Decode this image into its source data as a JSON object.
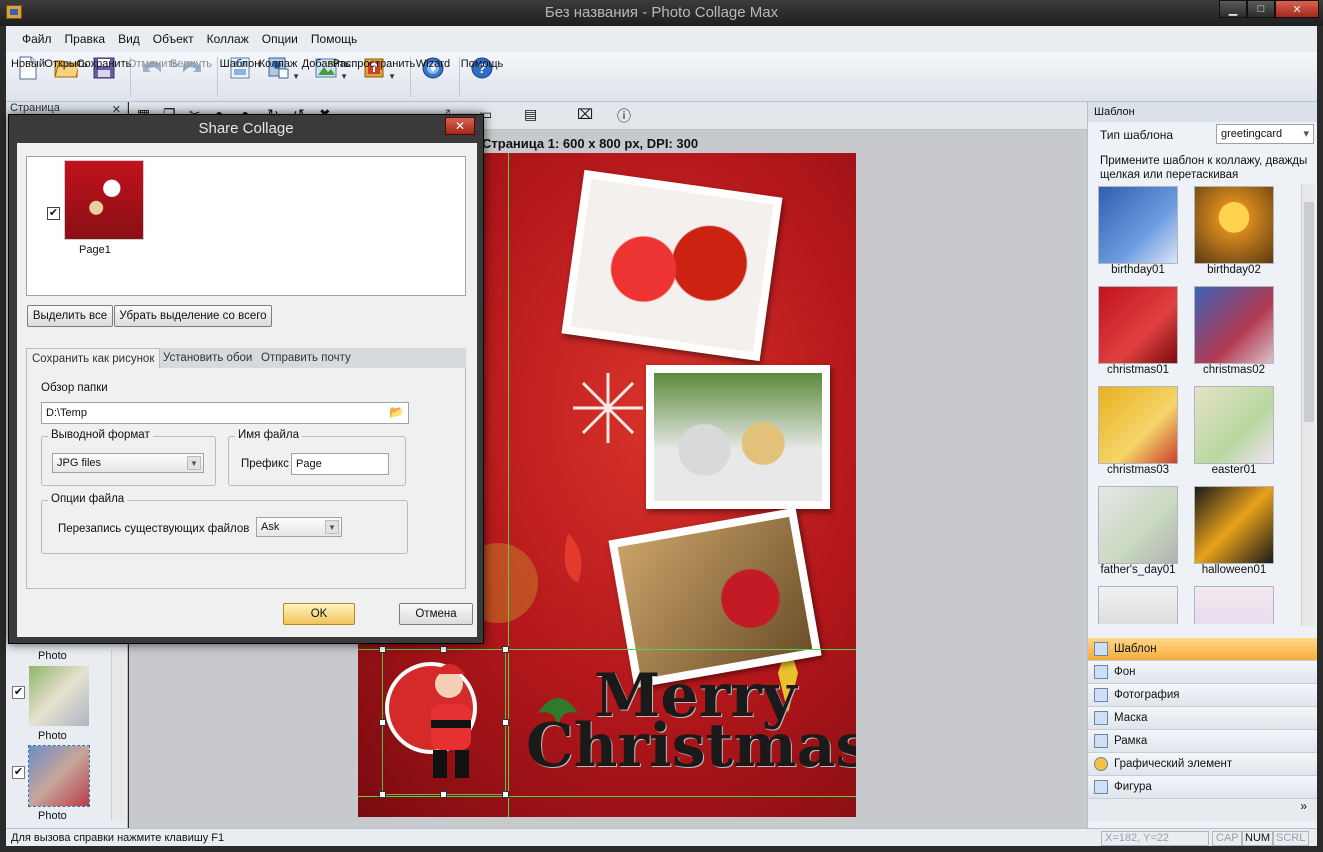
{
  "window": {
    "title": "Без названия - Photo Collage Max",
    "minimize": "▁",
    "maximize": "□",
    "close": "✕"
  },
  "menu": [
    "Файл",
    "Правка",
    "Вид",
    "Объект",
    "Коллаж",
    "Опции",
    "Помощь"
  ],
  "toolbar": {
    "buttons": [
      {
        "label": "Новый",
        "icon": "new-file-icon"
      },
      {
        "label": "Открыть",
        "icon": "open-folder-icon"
      },
      {
        "label": "Сохранить",
        "icon": "save-icon"
      },
      {
        "label": "Отменить",
        "icon": "undo-icon",
        "disabled": true
      },
      {
        "label": "Вернуть",
        "icon": "redo-icon",
        "disabled": true
      },
      {
        "label": "Шаблон",
        "icon": "template-icon"
      },
      {
        "label": "Коллаж",
        "icon": "collage-icon",
        "dropdown": true
      },
      {
        "label": "Добавить",
        "icon": "add-image-icon",
        "dropdown": true
      },
      {
        "label": "Распространить",
        "icon": "share-icon",
        "dropdown": true
      },
      {
        "label": "Wizard",
        "icon": "wizard-icon"
      },
      {
        "label": "Помощь",
        "icon": "help-icon"
      }
    ]
  },
  "left_panel": {
    "title": "Страница",
    "close": "✕",
    "photos": [
      {
        "caption": "Photo",
        "checked": true
      },
      {
        "caption": "Photo",
        "checked": true
      },
      {
        "caption": "Photo",
        "checked": true
      }
    ]
  },
  "canvas": {
    "page_info": "Страница 1: 600 x 800 px, DPI: 300",
    "greeting_line1": "Merry",
    "greeting_line2": "Christmas"
  },
  "right_panel": {
    "title": "Шаблон",
    "type_label": "Тип шаблона",
    "type_value": "greetingcard",
    "hint": "Примените шаблон к коллажу, дважды щелкая или перетаскивая",
    "templates": [
      {
        "name": "birthday01",
        "color": "#2f5fae"
      },
      {
        "name": "birthday02",
        "color": "#d88a1d"
      },
      {
        "name": "christmas01",
        "color": "#c1121f"
      },
      {
        "name": "christmas02",
        "color": "#3e63b8"
      },
      {
        "name": "christmas03",
        "color": "#e8b020"
      },
      {
        "name": "easter01",
        "color": "#e7e1c6"
      },
      {
        "name": "father's_day01",
        "color": "#e6e6e6"
      },
      {
        "name": "halloween01",
        "color": "#1a1a1a"
      }
    ],
    "sections": [
      {
        "label": "Шаблон",
        "active": true
      },
      {
        "label": "Фон"
      },
      {
        "label": "Фотография"
      },
      {
        "label": "Маска"
      },
      {
        "label": "Рамка"
      },
      {
        "label": "Графический элемент"
      },
      {
        "label": "Фигура"
      }
    ],
    "more": "»"
  },
  "statusbar": {
    "help": "Для вызова справки нажмите клавишу F1",
    "coords": "X=182, Y=22",
    "cap": "CAP",
    "num": "NUM",
    "scrl": "SCRL"
  },
  "dialog": {
    "title": "Share Collage",
    "close": "✕",
    "page_label": "Page1",
    "page_checked": true,
    "select_all": "Выделить все",
    "deselect_all": "Убрать выделение со всего",
    "tabs": [
      "Сохранить как рисунок",
      "Установить обои",
      "Отправить почту"
    ],
    "folder_label": "Обзор папки",
    "folder_value": "D:\\Temp",
    "format_group": "Выводной формат",
    "format_value": "JPG files",
    "filename_group": "Имя файла",
    "prefix_label": "Префикс",
    "prefix_value": "Page",
    "file_options_group": "Опции файла",
    "overwrite_label": "Перезапись существующих файлов",
    "overwrite_value": "Ask",
    "ok": "OK",
    "cancel": "Отмена"
  }
}
